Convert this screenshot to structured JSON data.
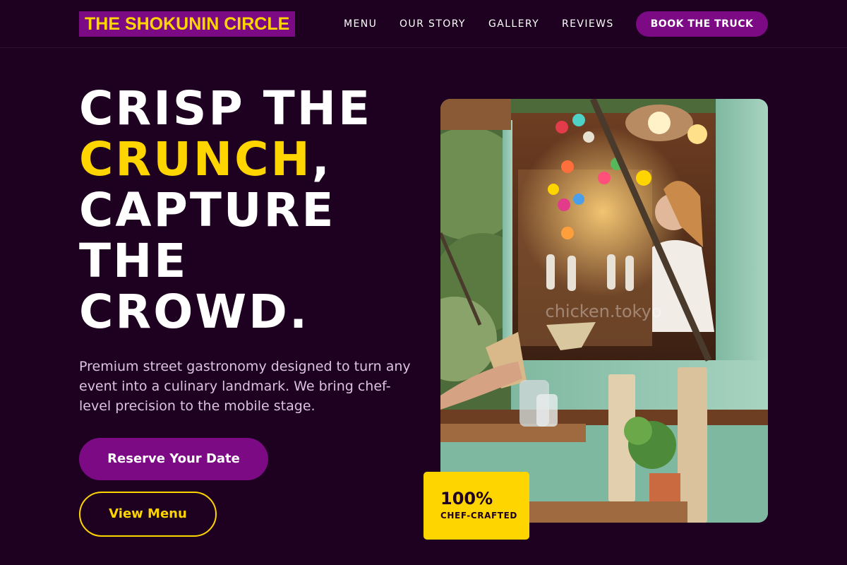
{
  "brand": {
    "name": "THE SHOKUNIN CIRCLE"
  },
  "nav": {
    "links": [
      "MENU",
      "OUR STORY",
      "GALLERY",
      "REVIEWS"
    ],
    "cta_label": "BOOK THE TRUCK"
  },
  "hero": {
    "headline": {
      "line1": "CRISP THE",
      "accent": "CRUNCH",
      "accent_suffix": ",",
      "line3": "CAPTURE",
      "line4": "THE",
      "line5": "CROWD."
    },
    "description": "Premium street gastronomy designed to turn any event into a culinary landmark. We bring chef-level precision to the mobile stage.",
    "primary_cta": "Reserve Your Date",
    "secondary_cta": "View Menu",
    "image": {
      "watermark": "chicken.tokyo"
    },
    "stat": {
      "value": "100%",
      "label": "CHEF-CRAFTED"
    }
  },
  "colors": {
    "background": "#1e0020",
    "brand_purple": "#7b0a84",
    "accent_yellow": "#ffd500",
    "text_muted": "#dcc4de"
  }
}
